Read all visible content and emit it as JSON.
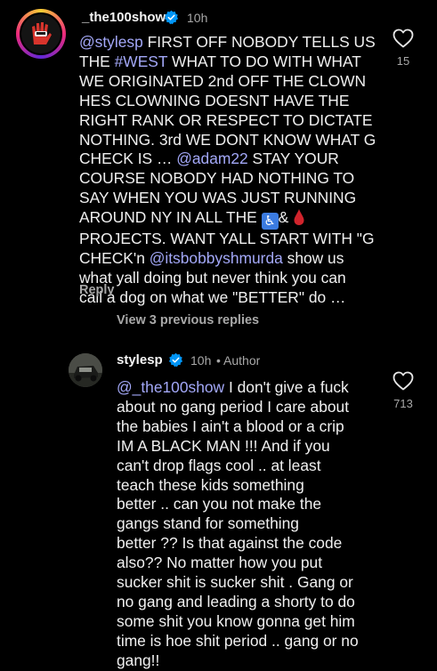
{
  "comment1": {
    "username": "_the100show",
    "time": "10h",
    "likes": "15",
    "lines": [
      [
        {
          "t": "@stylesp",
          "m": true
        },
        {
          "t": " FIRST OFF NOBODY TELLS US"
        }
      ],
      [
        {
          "t": "THE "
        },
        {
          "t": "#WEST",
          "m": true
        },
        {
          "t": " WHAT TO DO WITH WHAT"
        }
      ],
      [
        {
          "t": "WE ORIGINATED 2nd OFF THE CLOWN"
        }
      ],
      [
        {
          "t": "HES CLOWNING DOESNT HAVE THE"
        }
      ],
      [
        {
          "t": "RIGHT RANK OR RESPECT TO DICTATE"
        }
      ],
      [
        {
          "t": "NOTHING. 3rd WE DONT KNOW WHAT G"
        }
      ],
      [
        {
          "t": "CHECK IS … "
        },
        {
          "t": "@adam22",
          "m": true
        },
        {
          "t": " STAY YOUR"
        }
      ],
      [
        {
          "t": "COURSE NOBODY HAD NOTHING TO"
        }
      ],
      [
        {
          "t": "SAY WHEN YOU WAS JUST RUNNING"
        }
      ],
      [
        {
          "t": "AROUND NY IN ALL THE "
        },
        {
          "e": "accessible"
        },
        {
          "t": "& "
        },
        {
          "e": "drop"
        }
      ],
      [
        {
          "t": "PROJECTS. WANT YALL START WITH \"G"
        }
      ],
      [
        {
          "t": "CHECK'n "
        },
        {
          "t": "@itsbobbyshmurda",
          "m": true
        },
        {
          "t": " show us"
        }
      ],
      [
        {
          "t": "what yall doing but never think you can"
        }
      ],
      [
        {
          "t": "call a dog on what we \"BETTER\" do …"
        }
      ]
    ],
    "reply_label": "Reply"
  },
  "view_replies_label": "View 3 previous replies",
  "comment2": {
    "username": "stylesp",
    "time": "10h",
    "author_label": "• Author",
    "likes": "713",
    "lines": [
      [
        {
          "t": "@_the100show",
          "m": true
        },
        {
          "t": " I don't give a fuck"
        }
      ],
      [
        {
          "t": "about no gang period I care about"
        }
      ],
      [
        {
          "t": "the babies I ain't a blood or a crip"
        }
      ],
      [
        {
          "t": "IM A BLACK MAN !!! And if you"
        }
      ],
      [
        {
          "t": "can't  drop flags cool .. at least"
        }
      ],
      [
        {
          "t": "teach these kids something"
        }
      ],
      [
        {
          "t": "better .. can you not make the"
        }
      ],
      [
        {
          "t": "gangs stand for something"
        }
      ],
      [
        {
          "t": "better ?? Is that against the code"
        }
      ],
      [
        {
          "t": "also?? No matter how you put"
        }
      ],
      [
        {
          "t": "sucker shit is sucker shit . Gang or"
        }
      ],
      [
        {
          "t": "no gang and leading a shorty to do"
        }
      ],
      [
        {
          "t": "some shit you know gonna get him"
        }
      ],
      [
        {
          "t": "time is hoe shit period .. gang or no"
        }
      ],
      [
        {
          "t": "gang!!"
        }
      ]
    ]
  },
  "colors": {
    "background": "#000000",
    "mention": "#a3a8f8",
    "muted": "#a8a8a8",
    "verified": "#0095f6"
  },
  "icons": {
    "verified": "verified-badge-icon",
    "like": "heart-outline-icon",
    "accessible": "wheelchair-symbol-emoji",
    "drop": "drop-of-blood-emoji"
  }
}
